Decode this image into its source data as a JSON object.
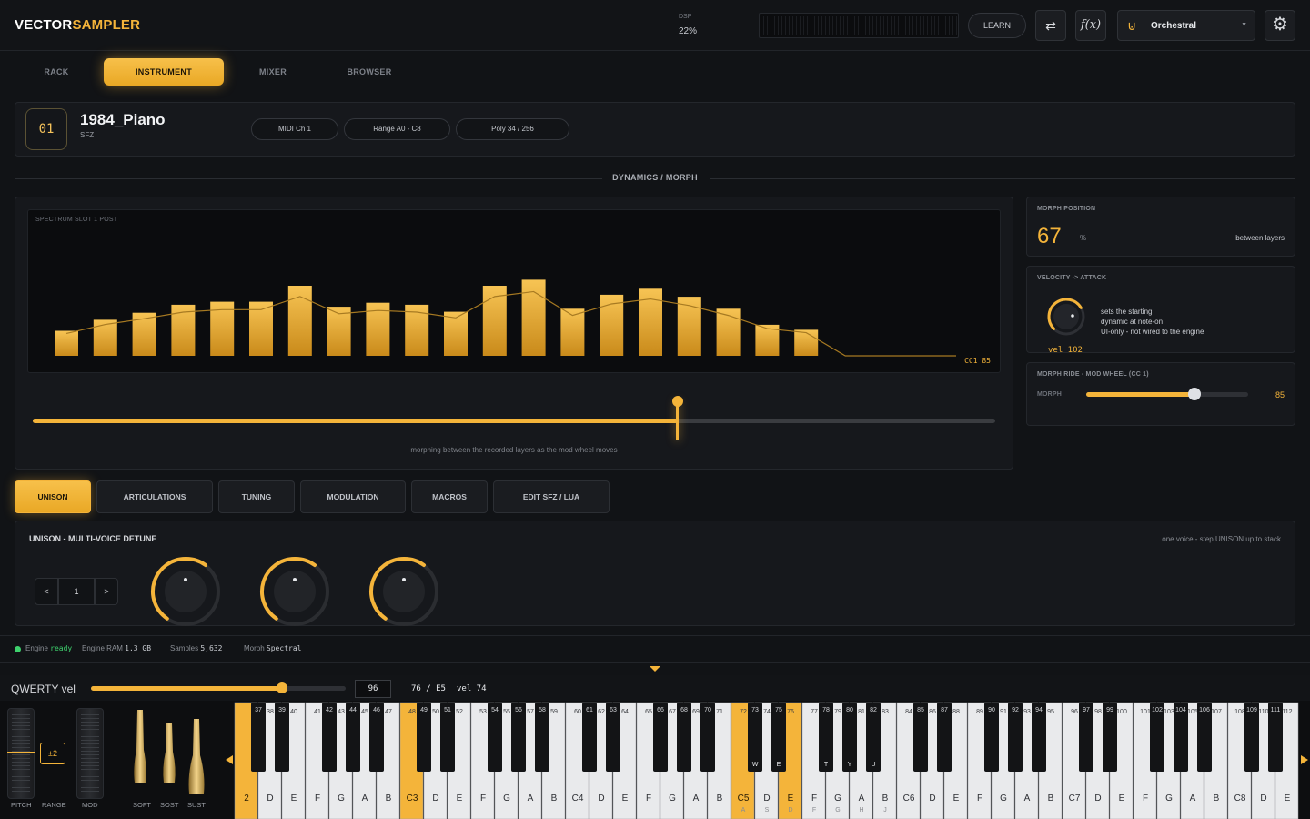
{
  "app": {
    "brand_left": "VECTOR",
    "brand_right": "SAMPLER"
  },
  "header": {
    "dsp_label": "DSP",
    "dsp_value": "22%",
    "learn_label": "LEARN",
    "swap_icon": "swap-icon",
    "fx_label": "f(x)",
    "preset_name": "Orchestral"
  },
  "tabs": [
    {
      "label": "RACK",
      "active": false
    },
    {
      "label": "INSTRUMENT",
      "active": true
    },
    {
      "label": "MIXER",
      "active": false
    },
    {
      "label": "BROWSER",
      "active": false
    }
  ],
  "instrument": {
    "slot": "01",
    "name": "1984_Piano",
    "format": "SFZ",
    "midi": "MIDI  Ch 1",
    "range": "Range  A0 - C8",
    "poly": "Poly  34 / 256"
  },
  "section_title": "DYNAMICS  /  MORPH",
  "spectrum": {
    "label": "SPECTRUM  SLOT 1  POST",
    "cc_label": "CC1   85",
    "bars": [
      0.25,
      0.36,
      0.43,
      0.51,
      0.54,
      0.54,
      0.7,
      0.49,
      0.53,
      0.51,
      0.44,
      0.7,
      0.76,
      0.47,
      0.61,
      0.67,
      0.59,
      0.47,
      0.31,
      0.26
    ]
  },
  "morph": {
    "value": 0.67,
    "caption": "morphing between the recorded layers as the mod wheel moves"
  },
  "right": {
    "morph_position_label": "MORPH POSITION",
    "morph_position_value": "67",
    "morph_position_unit": "%",
    "morph_position_note": "between layers",
    "vel_label": "VELOCITY -> ATTACK",
    "vel_desc_1": "sets the starting",
    "vel_desc_2": "dynamic at note-on",
    "vel_desc_3": "UI-only - not wired to the engine",
    "vel_value": "vel 102",
    "ride_label": "MORPH RIDE  -  MOD WHEEL (CC 1)",
    "ride_param": "MORPH",
    "ride_value": "85",
    "ride_fraction": 0.67
  },
  "section_tabs": [
    {
      "label": "UNISON",
      "active": true
    },
    {
      "label": "ARTICULATIONS",
      "active": false
    },
    {
      "label": "TUNING",
      "active": false
    },
    {
      "label": "MODULATION",
      "active": false
    },
    {
      "label": "MACROS",
      "active": false
    },
    {
      "label": "EDIT SFZ / LUA",
      "active": false
    }
  ],
  "unison": {
    "title": "UNISON  -  MULTI-VOICE DETUNE",
    "note": "one voice - step UNISON up to stack",
    "step_prev": "<",
    "step_value": "1",
    "step_next": ">"
  },
  "status": {
    "engine_label": "Engine",
    "engine_value": "ready",
    "ram_label": "Engine RAM",
    "ram_value": "1.3 GB",
    "samples_label": "Samples",
    "samples_value": "5,632",
    "morph_label": "Morph",
    "morph_value": "Spectral",
    "ready_color": "#3ed16d"
  },
  "keyboard_bar": {
    "label": "QWERTY vel",
    "vel_value": "96",
    "vel_fraction": 0.75,
    "note": "76 / E5",
    "vel_readout": "vel 74"
  },
  "controls": {
    "pitch": "PITCH",
    "range": "RANGE",
    "range_value": "±2",
    "mod": "MOD",
    "soft": "SOFT",
    "sost": "SOST",
    "sust": "SUST"
  },
  "keyboard": {
    "white_labels": [
      "2",
      "D",
      "E",
      "F",
      "G",
      "A",
      "B",
      "C3",
      "D",
      "E",
      "F",
      "G",
      "A",
      "B",
      "C4",
      "D",
      "E",
      "F",
      "G",
      "A",
      "B",
      "C5",
      "D",
      "E",
      "F",
      "G",
      "A",
      "B",
      "C6",
      "D",
      "E",
      "F",
      "G",
      "A",
      "B",
      "C7",
      "D",
      "E",
      "F",
      "G",
      "A",
      "B",
      "C8",
      "D",
      "E"
    ],
    "white_numbers": [
      "",
      "38",
      "40",
      "41",
      "43",
      "45",
      "47",
      "48",
      "50",
      "52",
      "53",
      "55",
      "57",
      "59",
      "60",
      "62",
      "64",
      "65",
      "67",
      "69",
      "71",
      "72",
      "74",
      "76",
      "77",
      "79",
      "81",
      "83",
      "84",
      "86",
      "88",
      "89",
      "91",
      "93",
      "95",
      "96",
      "98",
      "100",
      "101",
      "103",
      "105",
      "107",
      "108",
      "110",
      "112"
    ],
    "black_numbers": [
      "37",
      "39",
      "42",
      "44",
      "46",
      "49",
      "51",
      "54",
      "56",
      "58",
      "61",
      "63",
      "66",
      "68",
      "70",
      "73",
      "75",
      "78",
      "80",
      "82",
      "85",
      "87",
      "90",
      "92",
      "94",
      "97",
      "99",
      "102",
      "104",
      "106",
      "109",
      "111"
    ],
    "active_white": [
      0,
      7,
      21,
      23
    ],
    "qwerty_white": {
      "21": "A",
      "22": "S",
      "23": "D",
      "24": "F",
      "25": "G",
      "26": "H",
      "27": "J"
    },
    "qwerty_black": {
      "15": "W",
      "16": "E",
      "17": "T",
      "18": "Y",
      "19": "U"
    }
  },
  "accent": "#f4b43a"
}
